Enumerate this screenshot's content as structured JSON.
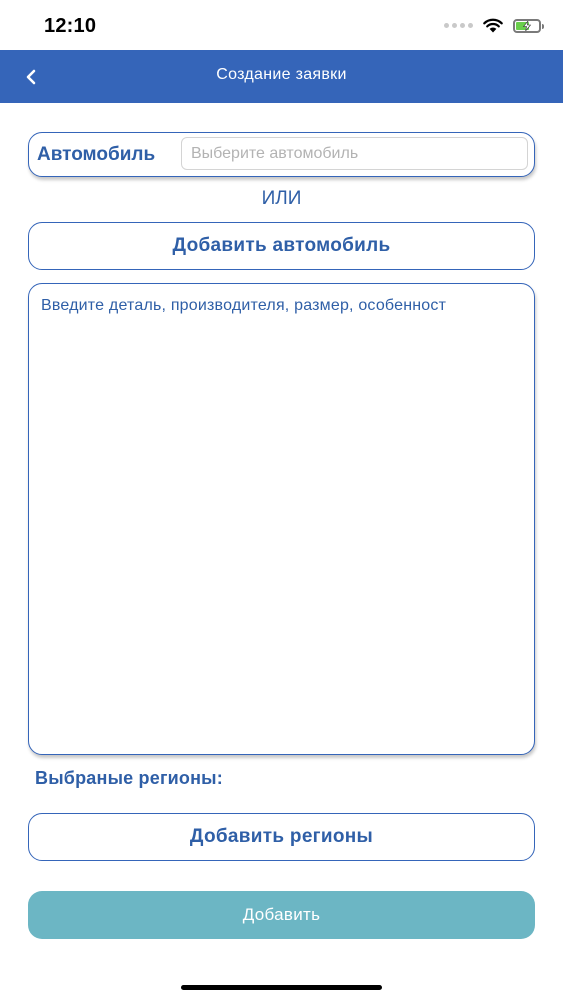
{
  "status_bar": {
    "time": "12:10"
  },
  "nav": {
    "title": "Создание заявки",
    "back_icon": "chevron-left-icon"
  },
  "car": {
    "label": "Автомобиль",
    "placeholder": "Выберите автомобиль",
    "value": ""
  },
  "or_text": "ИЛИ",
  "add_car_label": "Добавить автомобиль",
  "details": {
    "placeholder": "Введите деталь, производителя, размер, особенност",
    "value": ""
  },
  "regions": {
    "label": "Выбраные регионы:",
    "add_label": "Добавить регионы"
  },
  "submit_label": "Добавить",
  "colors": {
    "brand_blue": "#3565b9",
    "text_blue": "#2f5fa7",
    "submit_teal": "#6cb6c4",
    "battery_green": "#6acf4b"
  }
}
